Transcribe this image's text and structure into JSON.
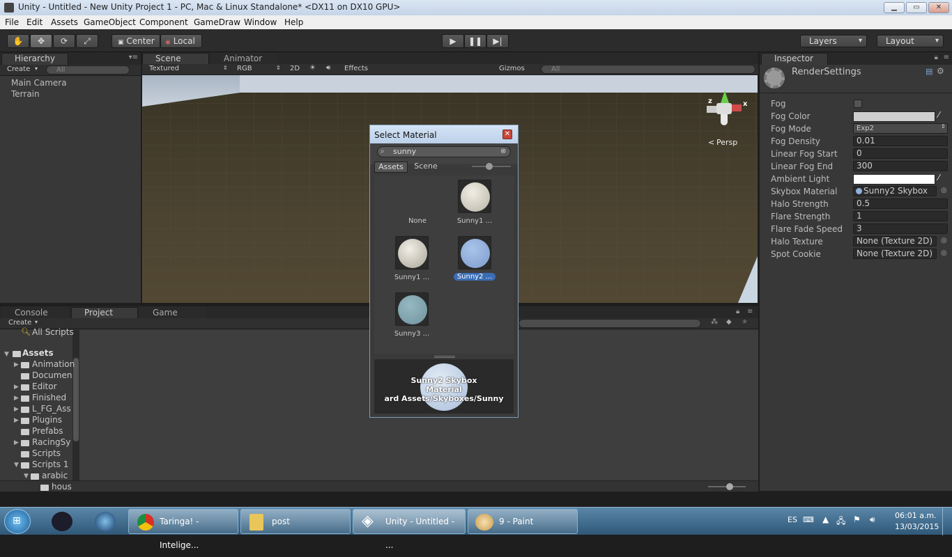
{
  "window": {
    "title": "Unity - Untitled - New Unity Project 1 - PC, Mac & Linux Standalone* <DX11 on DX10 GPU>",
    "buttons": [
      "▁",
      "▭",
      "✕"
    ]
  },
  "menu": [
    "File",
    "Edit",
    "Assets",
    "GameObject",
    "Component",
    "GameDraw",
    "Window",
    "Help"
  ],
  "toolbar": {
    "pivot": "Center",
    "space": "Local",
    "layers": "Layers",
    "layout": "Layout"
  },
  "hierarchy": {
    "tab": "Hierarchy",
    "create": "Create",
    "search_placeholder": "All",
    "items": [
      "Main Camera",
      "Terrain"
    ]
  },
  "scene": {
    "tab_scene": "Scene",
    "tab_animator": "Animator",
    "render_mode": "Textured",
    "color_mode": "RGB",
    "toggle_2d": "2D",
    "effects": "Effects",
    "gizmos": "Gizmos",
    "search_placeholder": "All",
    "persp_label": "Persp",
    "axis_labels": {
      "x": "x",
      "z": "z"
    }
  },
  "bottom": {
    "tab_console": "Console",
    "tab_project": "Project",
    "tab_game": "Game",
    "create": "Create",
    "favorites_item": "All Scripts",
    "assets_root": "Assets",
    "folders": [
      "Animation",
      "Documen",
      "Editor",
      "Finished",
      "L_FG_Ass",
      "Plugins",
      "Prefabs",
      "RacingSy",
      "Scripts",
      "Scripts 1",
      "arabic",
      "hous"
    ]
  },
  "inspector": {
    "tab": "Inspector",
    "header": "RenderSettings",
    "rows": [
      {
        "label": "Fog",
        "value": ""
      },
      {
        "label": "Fog Color",
        "value": ""
      },
      {
        "label": "Fog Mode",
        "value": "Exp2"
      },
      {
        "label": "Fog Density",
        "value": "0.01"
      },
      {
        "label": "Linear Fog Start",
        "value": "0"
      },
      {
        "label": "Linear Fog End",
        "value": "300"
      },
      {
        "label": "Ambient Light",
        "value": ""
      },
      {
        "label": "Skybox Material",
        "value": "Sunny2 Skybox"
      },
      {
        "label": "Halo Strength",
        "value": "0.5"
      },
      {
        "label": "Flare Strength",
        "value": "1"
      },
      {
        "label": "Flare Fade Speed",
        "value": "3"
      },
      {
        "label": "Halo Texture",
        "value": "None (Texture 2D)"
      },
      {
        "label": "Spot Cookie",
        "value": "None (Texture 2D)"
      }
    ],
    "fog_enabled": false,
    "fog_color": "#cfcfcf",
    "ambient_color": "#ffffff"
  },
  "dialog": {
    "title": "Select Material",
    "search_value": "sunny",
    "tab_assets": "Assets",
    "tab_scene": "Scene",
    "items": [
      {
        "label": "None",
        "color": "none",
        "selected": false
      },
      {
        "label": "Sunny1 ...",
        "color": "#d9d5c8",
        "selected": false
      },
      {
        "label": "Sunny1 ...",
        "color": "#d4cfc0",
        "selected": false
      },
      {
        "label": "Sunny2 ...",
        "color": "#8fb0dc",
        "selected": true
      },
      {
        "label": "Sunny3 ...",
        "color": "#7fa4b0",
        "selected": false
      }
    ],
    "preview_name": "Sunny2 Skybox",
    "preview_type": "Material",
    "preview_path": "ard Assets/Skyboxes/Sunny"
  },
  "taskbar": {
    "items": [
      "Taringa! - Intelige...",
      "post",
      "Unity - Untitled - ...",
      "9 - Paint"
    ],
    "lang": "ES",
    "time": "06:01 a.m.",
    "date": "13/03/2015"
  },
  "colors": {
    "selection": "#3b6db5",
    "panel": "#383838"
  }
}
